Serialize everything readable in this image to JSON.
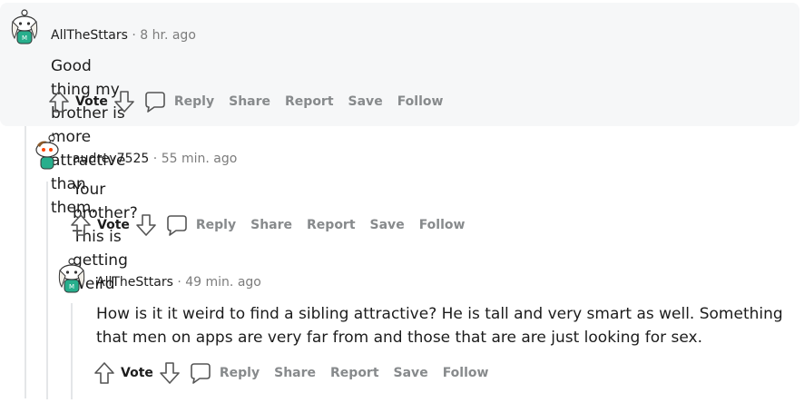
{
  "comments": [
    {
      "author": "AllTheSttars",
      "time": "8 hr. ago",
      "body": "Good thing my brother is more attractive than them."
    },
    {
      "author": "audrey7525",
      "time": "55 min. ago",
      "body": "Your brother? This is getting weird"
    },
    {
      "author": "AllTheSttars",
      "time": "49 min. ago",
      "body": "How is it it weird to find a sibling attractive? He is tall and very smart as well. Something that men on apps are very far from and those that are are just looking for sex."
    }
  ],
  "actions": {
    "vote": "Vote",
    "reply": "Reply",
    "share": "Share",
    "report": "Report",
    "save": "Save",
    "follow": "Follow"
  },
  "meta_separator": "·",
  "icons": [
    "upvote-arrow-icon",
    "downvote-arrow-icon",
    "speech-bubble-icon",
    "snoo-avatar-icon"
  ],
  "colors": {
    "highlight_bg": "#f6f7f8",
    "action_text": "#878a8c",
    "meta_text": "#7c7c7c",
    "thread_line": "#e4e6e8",
    "avatar_shirt": "#27ae8c"
  }
}
